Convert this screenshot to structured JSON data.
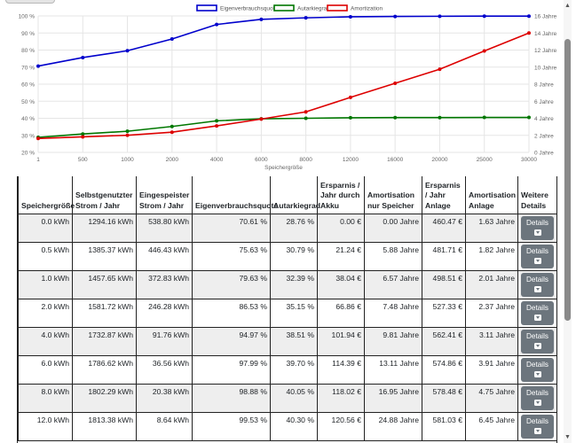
{
  "chart_data": {
    "type": "line",
    "categories": [
      "1",
      "500",
      "1000",
      "2000",
      "4000",
      "6000",
      "8000",
      "12000",
      "16000",
      "20000",
      "25000",
      "30000"
    ],
    "xlabel": "Speichergröße",
    "y_left": {
      "ticks": [
        "20 %",
        "30 %",
        "40 %",
        "50 %",
        "60 %",
        "70 %",
        "80 %",
        "90 %",
        "100 %"
      ],
      "min": 20,
      "max": 100
    },
    "y_right": {
      "ticks": [
        "0 Jahre",
        "2 Jahre",
        "4 Jahre",
        "6 Jahre",
        "8 Jahre",
        "10 Jahre",
        "12 Jahre",
        "14 Jahre",
        "16 Jahre"
      ],
      "min": 0,
      "max": 16
    },
    "legend_position": "top-center",
    "grid": true,
    "series": [
      {
        "name": "Eigenverbrauchsquote",
        "axis": "left",
        "color": "#0000cc",
        "values": [
          70.6,
          75.6,
          79.6,
          86.5,
          95.0,
          98.0,
          98.9,
          99.5,
          99.7,
          99.8,
          99.9,
          99.9
        ]
      },
      {
        "name": "Autarkiegrad",
        "axis": "left",
        "color": "#007700",
        "values": [
          28.8,
          30.8,
          32.4,
          35.2,
          38.5,
          39.7,
          40.0,
          40.3,
          40.4,
          40.4,
          40.5,
          40.5
        ]
      },
      {
        "name": "Amortization",
        "axis": "right",
        "color": "#dd0000",
        "values": [
          1.63,
          1.82,
          2.01,
          2.37,
          3.11,
          3.91,
          4.75,
          6.45,
          8.1,
          9.75,
          11.9,
          14.0
        ]
      }
    ]
  },
  "table": {
    "headers": [
      "Speichergröße",
      "Selbstgenutzter Strom / Jahr",
      "Eingespeister Strom / Jahr",
      "Eigenverbrauchsquote",
      "Autarkiegrad",
      "Ersparnis / Jahr durch Akku",
      "Amortisation nur Speicher",
      "Ersparnis / Jahr Anlage",
      "Amortisation Anlage",
      "Weitere Details"
    ],
    "details_label": "Details",
    "rows": [
      [
        "0.0 kWh",
        "1294.16 kWh",
        "538.80 kWh",
        "70.61 %",
        "28.76 %",
        "0.00 €",
        "0.00 Jahre",
        "460.47 €",
        "1.63 Jahre"
      ],
      [
        "0.5 kWh",
        "1385.37 kWh",
        "446.43 kWh",
        "75.63 %",
        "30.79 %",
        "21.24 €",
        "5.88 Jahre",
        "481.71 €",
        "1.82 Jahre"
      ],
      [
        "1.0 kWh",
        "1457.65 kWh",
        "372.83 kWh",
        "79.63 %",
        "32.39 %",
        "38.04 €",
        "6.57 Jahre",
        "498.51 €",
        "2.01 Jahre"
      ],
      [
        "2.0 kWh",
        "1581.72 kWh",
        "246.28 kWh",
        "86.53 %",
        "35.15 %",
        "66.86 €",
        "7.48 Jahre",
        "527.33 €",
        "2.37 Jahre"
      ],
      [
        "4.0 kWh",
        "1732.87 kWh",
        "91.76 kWh",
        "94.97 %",
        "38.51 %",
        "101.94 €",
        "9.81 Jahre",
        "562.41 €",
        "3.11 Jahre"
      ],
      [
        "6.0 kWh",
        "1786.62 kWh",
        "36.56 kWh",
        "97.99 %",
        "39.70 %",
        "114.39 €",
        "13.11 Jahre",
        "574.86 €",
        "3.91 Jahre"
      ],
      [
        "8.0 kWh",
        "1802.29 kWh",
        "20.38 kWh",
        "98.88 %",
        "40.05 %",
        "118.02 €",
        "16.95 Jahre",
        "578.48 €",
        "4.75 Jahre"
      ],
      [
        "12.0 kWh",
        "1813.38 kWh",
        "8.64 kWh",
        "99.53 %",
        "40.30 %",
        "120.56 €",
        "24.88 Jahre",
        "581.03 €",
        "6.45 Jahre"
      ]
    ]
  }
}
